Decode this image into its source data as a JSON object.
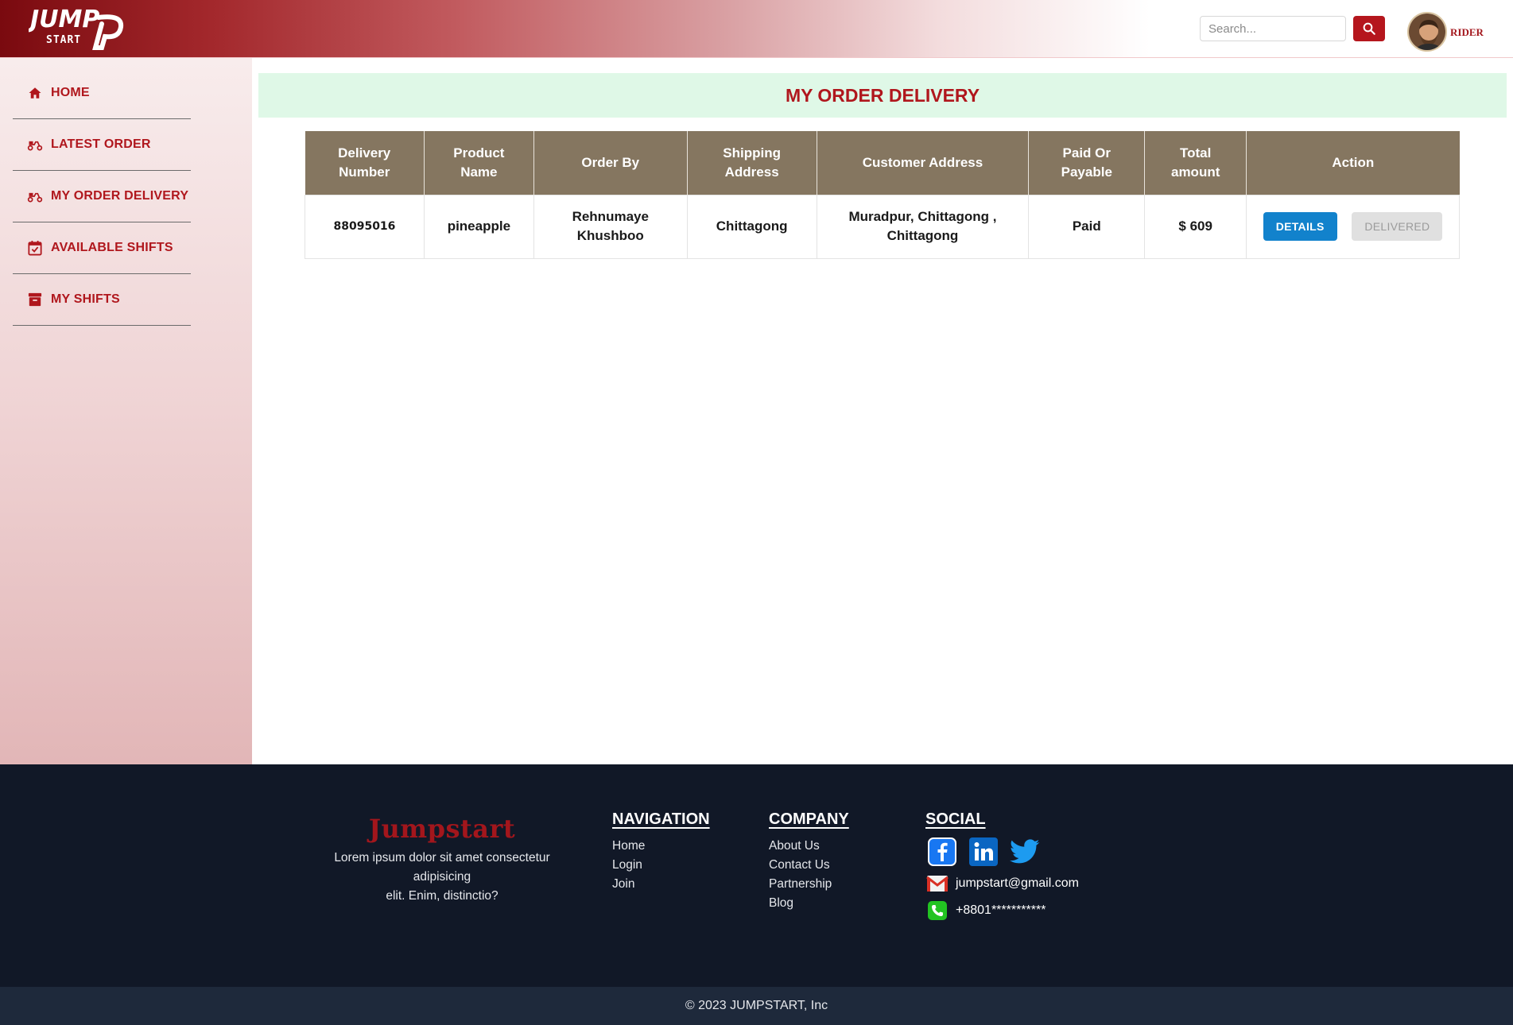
{
  "header": {
    "logo_top": "JUMP",
    "logo_bottom": "START",
    "search_placeholder": "Search...",
    "user_role": "RIDER"
  },
  "sidebar": {
    "items": [
      {
        "label": "HOME",
        "icon": "home-icon"
      },
      {
        "label": "LATEST ORDER",
        "icon": "scooter-icon"
      },
      {
        "label": "MY ORDER DELIVERY",
        "icon": "scooter-icon"
      },
      {
        "label": "AVAILABLE SHIFTS",
        "icon": "calendar-check-icon"
      },
      {
        "label": "MY SHIFTS",
        "icon": "archive-icon"
      }
    ]
  },
  "main": {
    "title": "MY ORDER DELIVERY",
    "table": {
      "headers": {
        "delivery_number": [
          "Delivery",
          "Number"
        ],
        "product_name": [
          "Product",
          "Name"
        ],
        "order_by": "Order By",
        "shipping_address": [
          "Shipping",
          "Address"
        ],
        "customer_address": "Customer Address",
        "paid_or_payable": [
          "Paid Or",
          "Payable"
        ],
        "total_amount": [
          "Total",
          "amount"
        ],
        "action": "Action"
      },
      "rows": [
        {
          "delivery_number": "88095016",
          "product_name": "pineapple",
          "order_by": [
            "Rehnumaye",
            "Khushboo"
          ],
          "shipping_address": "Chittagong",
          "customer_address": [
            "Muradpur, Chittagong ,",
            "Chittagong"
          ],
          "paid_or_payable": "Paid",
          "total_amount": "$ 609",
          "details_label": "DETAILS",
          "delivered_label": "DELIVERED"
        }
      ]
    }
  },
  "footer": {
    "brand": "Jumpstart",
    "description_line1": "Lorem ipsum dolor sit amet consectetur adipisicing",
    "description_line2": "elit. Enim, distinctio?",
    "navigation": {
      "heading": "NAVIGATION",
      "links": [
        "Home",
        "Login",
        "Join"
      ]
    },
    "company": {
      "heading": "COMPANY",
      "links": [
        "About Us",
        "Contact Us",
        "Partnership",
        "Blog"
      ]
    },
    "social": {
      "heading": "SOCIAL",
      "icons": [
        "facebook-icon",
        "linkedin-icon",
        "twitter-icon"
      ],
      "email": "jumpstart@gmail.com",
      "phone": "+8801***********"
    },
    "copyright": "© 2023 JUMPSTART, Inc"
  },
  "colors": {
    "brand_red": "#b0171d",
    "table_header": "#857660",
    "title_bg": "#dff8e7",
    "details_button": "#1282cc",
    "footer_bg": "#111827"
  }
}
